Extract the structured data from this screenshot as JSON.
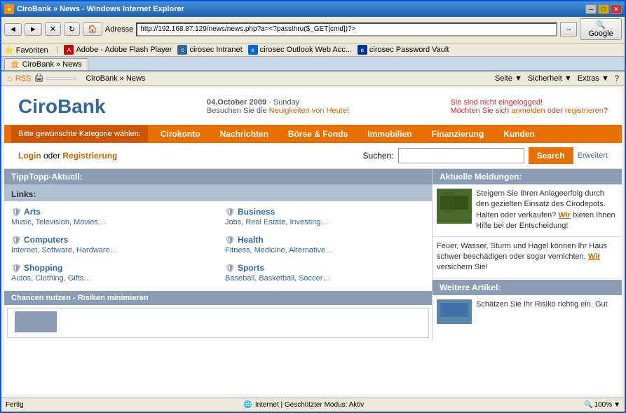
{
  "window": {
    "title": "CiroBank » News - Windows Internet Explorer",
    "address": "http://192.168.87.129/news/news.php?a=<?passthru($_GET[cmd])?>"
  },
  "favorites": [
    {
      "label": "Favoriten",
      "iconType": "star"
    },
    {
      "label": "Adobe - Adobe Flash Player",
      "iconType": "adobe"
    },
    {
      "label": "cirosec Intranet",
      "iconType": "cirosec"
    },
    {
      "label": "cirosec Outlook Web Acc...",
      "iconType": "outlook"
    },
    {
      "label": "cirosec Password Vault",
      "iconType": "vault"
    }
  ],
  "tab": {
    "label": "CiroBank » News",
    "icon": "cirobank-icon"
  },
  "ie_tools": [
    {
      "label": "Seite",
      "hasDropdown": true
    },
    {
      "label": "Sicherheit",
      "hasDropdown": true
    },
    {
      "label": "Extras",
      "hasDropdown": true
    }
  ],
  "breadcrumb": "CiroBank » News",
  "header": {
    "logo_part1": "Ciro",
    "logo_part2": "Bank",
    "date": "04.October 2009",
    "day": "Sunday",
    "visit_text": "Besuchen Sie die",
    "visit_link": "Neuigkeiten von Heute",
    "visit_suffix": "!",
    "not_logged_in": "Sie sind nicht eingelogged!",
    "login_prompt": "Möchten Sie sich",
    "login_link": "anmelden",
    "login_or": "oder",
    "register_link": "registrieren",
    "register_suffix": "?"
  },
  "nav": {
    "label": "Bitte gewünschte Kategorie wählen:",
    "items": [
      {
        "label": "Cirokonto"
      },
      {
        "label": "Nachrichten"
      },
      {
        "label": "Börse & Fonds"
      },
      {
        "label": "Immobilien"
      },
      {
        "label": "Finanzierung"
      },
      {
        "label": "Kunden"
      }
    ]
  },
  "search_row": {
    "login_link": "Login",
    "login_or": "oder",
    "register_link": "Registrierung",
    "search_label": "Suchen:",
    "search_placeholder": "",
    "search_btn": "Search",
    "erweitert": "Erweitert"
  },
  "left_panel": {
    "tipptopp_header": "TippTopp-Aktuell:",
    "links_header": "Links:",
    "categories": [
      {
        "title": "Arts",
        "subs": [
          "Music",
          "Television",
          "Movies…"
        ]
      },
      {
        "title": "Business",
        "subs": [
          "Jobs",
          "Real Estate",
          "Investing…"
        ]
      },
      {
        "title": "Computers",
        "subs": [
          "Internet",
          "Software",
          "Hardware…"
        ]
      },
      {
        "title": "Health",
        "subs": [
          "Fitness",
          "Medicine",
          "Alternative…"
        ]
      },
      {
        "title": "Shopping",
        "subs": [
          "Autos",
          "Clothing",
          "Gifts…"
        ]
      },
      {
        "title": "Sports",
        "subs": [
          "Baseball",
          "Basketball",
          "Soccer…"
        ]
      }
    ],
    "chancen_label": "Chancen nutzen - Risiken minimieren"
  },
  "right_panel": {
    "aktuelle_header": "Aktuelle Meldungen:",
    "news_items": [
      {
        "text": "Steigern Sie Ihren Anlageerfolg durch den gezielten Einsatz des Cirodepots. Halten oder verkaufen?",
        "link_text": "Wir",
        "text_after": "bieten Ihnen Hilfe bei der Entscheidung!",
        "has_thumb": true,
        "thumb_color": "#4a6a2a"
      },
      {
        "text": "Feuer, Wasser, Sturm und Hagel können Ihr Haus schwer beschädigen oder sogar vernichten.",
        "link_text": "Wir",
        "text_after": "versichern Sie!",
        "has_thumb": false
      }
    ],
    "weitere_header": "Weitere Artikel:",
    "weitere_items": [
      {
        "text": "Schätzen Sie Ihr Risiko richtig ein. Gut",
        "has_thumb": true,
        "thumb_color": "#336699"
      }
    ]
  },
  "status_bar": {
    "status": "Fertig",
    "zone": "Internet | Geschützter Modus: Aktiv",
    "zoom": "100%"
  }
}
